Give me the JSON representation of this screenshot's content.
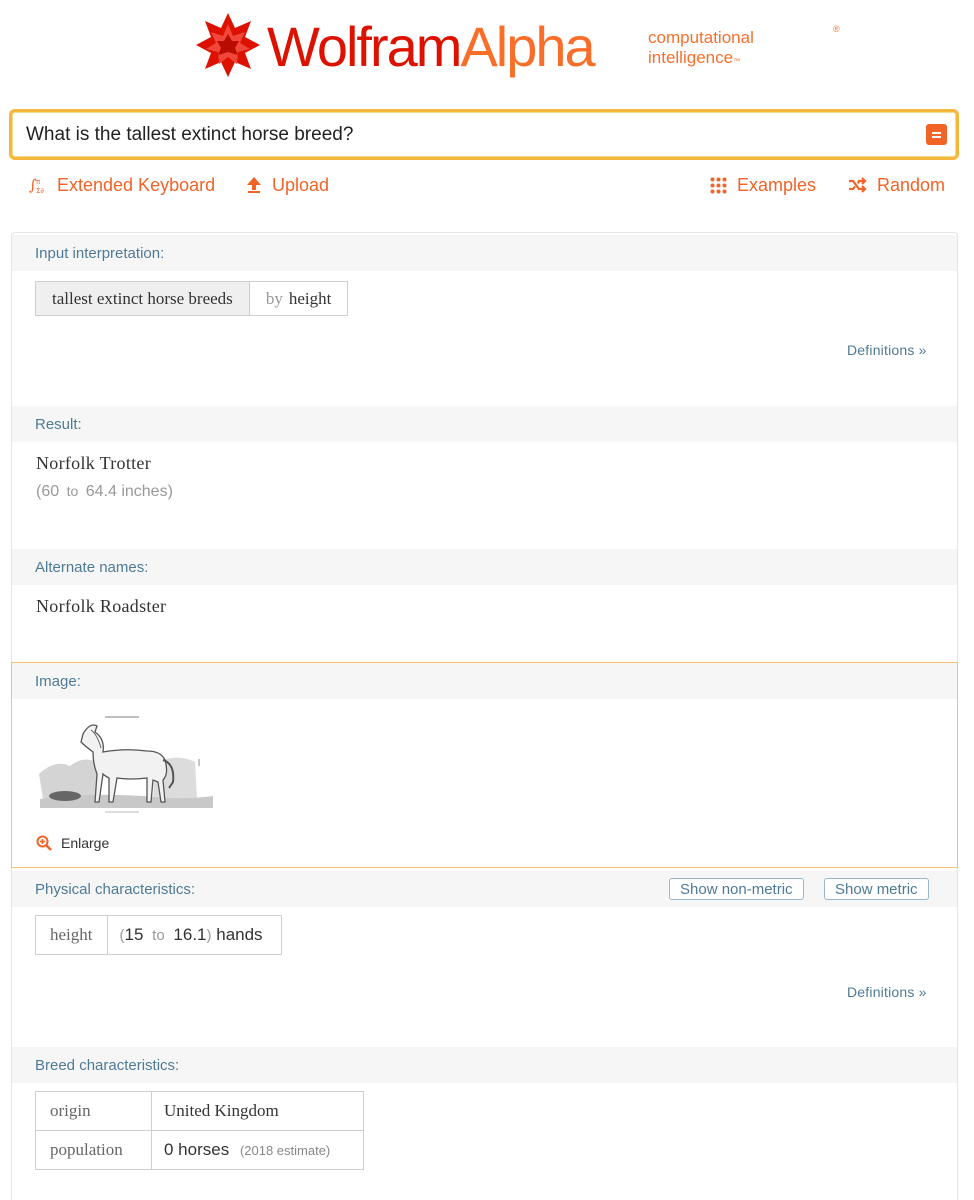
{
  "logo": {
    "word_part1": "Wolfram",
    "word_part2": "Alpha",
    "registered": "®",
    "tagline_line1": "computational",
    "tagline_line2": "intelligence",
    "tagline_tm": "™"
  },
  "search": {
    "value": "What is the tallest extinct horse breed?"
  },
  "toolbar": {
    "extended_keyboard": "Extended Keyboard",
    "upload": "Upload",
    "examples": "Examples",
    "random": "Random"
  },
  "pods": {
    "input_interpretation": {
      "title": "Input interpretation:",
      "query": "tallest extinct horse breeds",
      "by_word": "by",
      "by_value": "height",
      "definitions": "Definitions »"
    },
    "result": {
      "title": "Result:",
      "value": "Norfolk Trotter",
      "range_open": "(",
      "range_low": "60",
      "range_to": "to",
      "range_high": "64.4",
      "range_unit": "inches",
      "range_close": ")"
    },
    "alternate_names": {
      "title": "Alternate names:",
      "value": "Norfolk Roadster"
    },
    "image": {
      "title": "Image:",
      "enlarge": "Enlarge"
    },
    "physical": {
      "title": "Physical characteristics:",
      "show_non_metric": "Show non-metric",
      "show_metric": "Show metric",
      "label": "height",
      "open": "(",
      "low": "15",
      "to": "to",
      "high": "16.1",
      "close": ")",
      "unit": "hands",
      "definitions": "Definitions »"
    },
    "breed": {
      "title": "Breed characteristics:",
      "rows": [
        {
          "label": "origin",
          "value": "United Kingdom",
          "note": ""
        },
        {
          "label": "population",
          "value": "0 horses",
          "note": "(2018 estimate)"
        }
      ]
    }
  },
  "colors": {
    "brand_red": "#dd1100",
    "brand_orange": "#f96f2a",
    "link_orange": "#f16327",
    "pod_title_blue": "#4f7a96",
    "search_border": "#f5b73b"
  }
}
